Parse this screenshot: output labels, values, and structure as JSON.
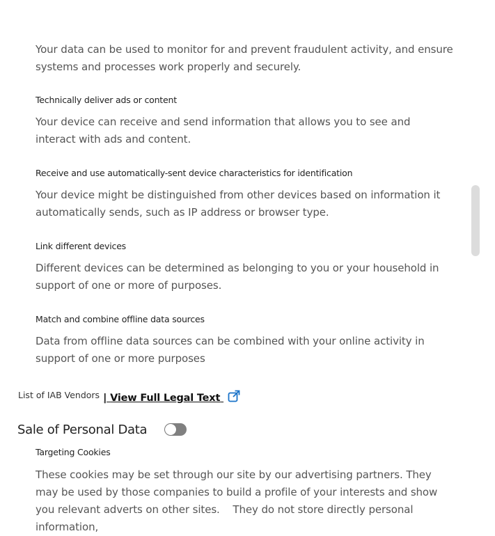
{
  "purposes": [
    {
      "title": "",
      "description": "Your data can be used to monitor for and prevent fraudulent activity, and ensure systems and processes work properly and securely."
    },
    {
      "title": "Technically deliver ads or content",
      "description": "Your device can receive and send information that allows you to see and interact with ads and content."
    },
    {
      "title": "Receive and use automatically-sent device characteristics for identification",
      "description": "Your device might be distinguished from other devices based on information it automatically sends, such as IP address or browser type."
    },
    {
      "title": "Link different devices",
      "description": "Different devices can be determined as belonging to you or your household in support of one or more of purposes."
    },
    {
      "title": "Match and combine offline data sources",
      "description": "Data from offline data sources can be combined with your online activity in support of one or more purposes"
    }
  ],
  "vendors": {
    "label": "List of IAB Vendors",
    "separator": "|",
    "legal_link": "View Full Legal Text",
    "icon": "external-link-icon",
    "link_color": "#1a73c9"
  },
  "sale_of_personal_data": {
    "title": "Sale of Personal Data",
    "toggle_on": false,
    "toggle_color": "#808080"
  },
  "targeting": {
    "title": "Targeting Cookies",
    "description": "These cookies may be set through our site by our advertising partners. They may be used by those companies to build a profile of your interests and show you relevant adverts on other sites.    They do not store directly personal information,"
  }
}
